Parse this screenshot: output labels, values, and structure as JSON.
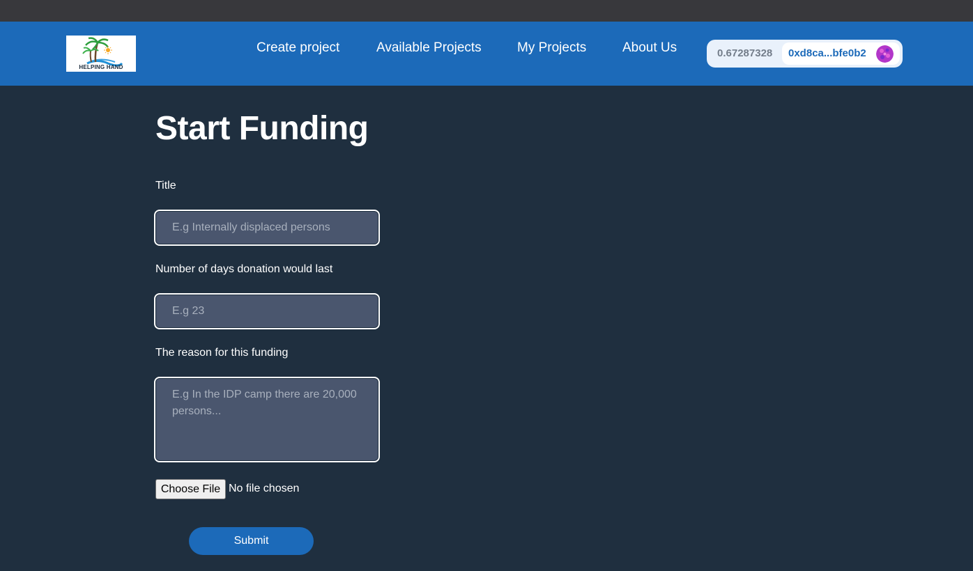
{
  "header": {
    "logo_text": "HELPING HAND",
    "nav": [
      {
        "label": "Create project"
      },
      {
        "label": "Available Projects"
      },
      {
        "label": "My Projects"
      },
      {
        "label": "About Us"
      }
    ],
    "wallet": {
      "balance": "0.67287328",
      "address": "0xd8ca...bfe0b2"
    }
  },
  "form": {
    "heading": "Start Funding",
    "title_label": "Title",
    "title_placeholder": "E.g Internally displaced persons",
    "days_label": "Number of days donation would last",
    "days_placeholder": "E.g 23",
    "reason_label": "The reason for this funding",
    "reason_placeholder": "E.g In the IDP camp there are 20,000 persons...",
    "file_button": "Choose File",
    "file_status": "No file chosen",
    "submit_label": "Submit"
  },
  "colors": {
    "nav_background": "#1c6ab9",
    "page_background": "#1f2f3f",
    "field_background": "#4a566e"
  }
}
